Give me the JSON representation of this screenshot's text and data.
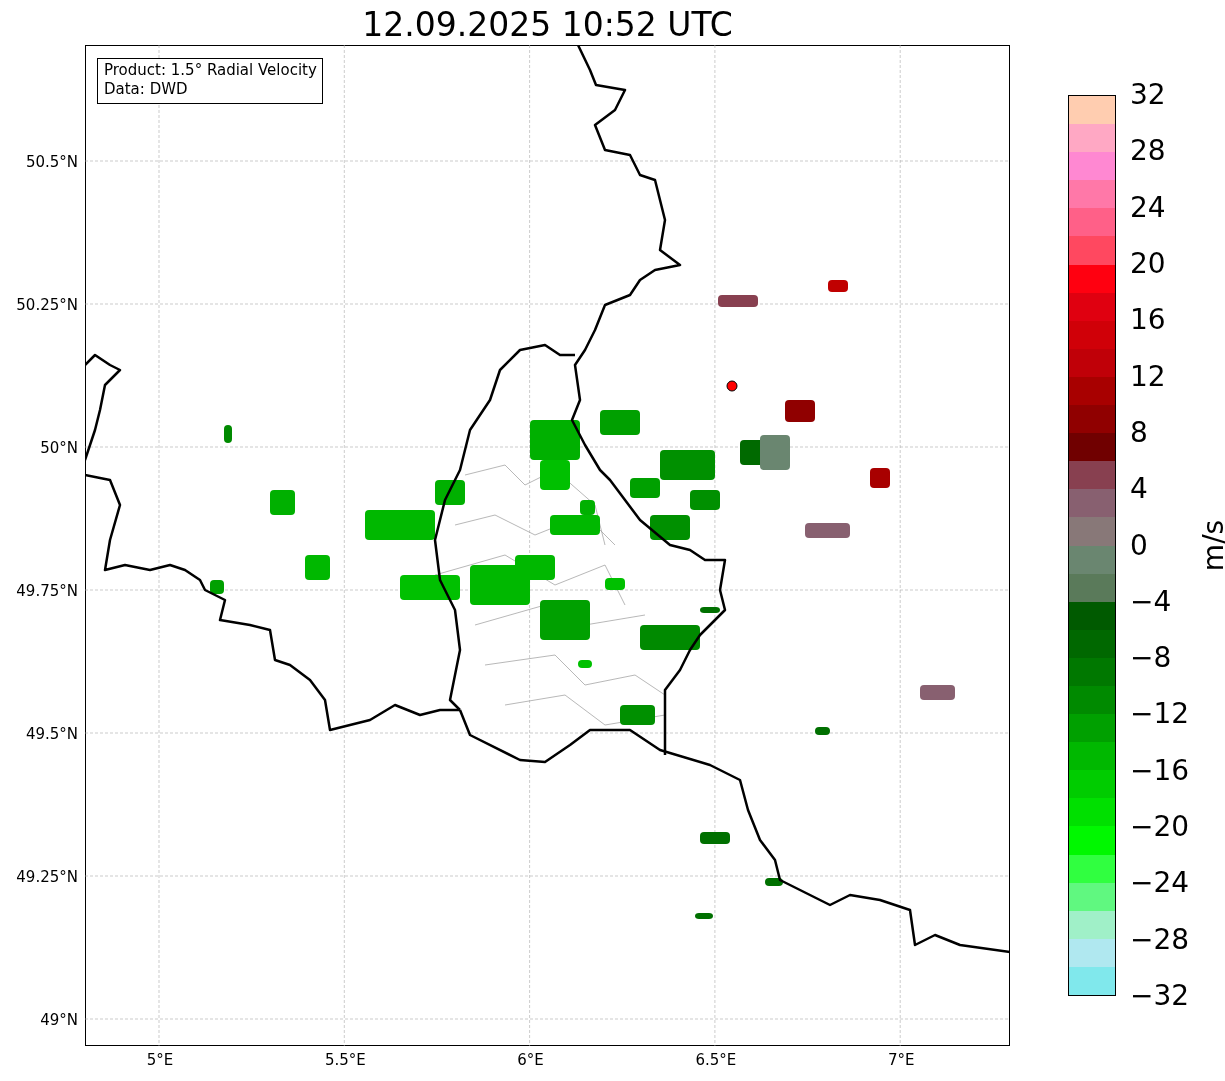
{
  "title": "12.09.2025 10:52 UTC",
  "info_box": {
    "lines": [
      "Product: 1.5° Radial Velocity",
      "Data: DWD"
    ]
  },
  "map": {
    "lat_labels": [
      "50.5°N",
      "50.25°N",
      "50°N",
      "49.75°N",
      "49.5°N",
      "49.25°N",
      "49°N"
    ],
    "lon_labels": [
      "5°E",
      "5.5°E",
      "6°E",
      "6.5°E",
      "7°E"
    ]
  },
  "colorbar": {
    "label": "m/s",
    "ticks": [
      "32",
      "28",
      "24",
      "20",
      "16",
      "12",
      "8",
      "4",
      "0",
      "−4",
      "−8",
      "−12",
      "−16",
      "−20",
      "−24",
      "−28",
      "−32"
    ],
    "bands": [
      {
        "color": "#ffcdb0"
      },
      {
        "color": "#ffa8c4"
      },
      {
        "color": "#ff88d2"
      },
      {
        "color": "#ff78a8"
      },
      {
        "color": "#ff6088"
      },
      {
        "color": "#ff4860"
      },
      {
        "color": "#ff0010"
      },
      {
        "color": "#e00010"
      },
      {
        "color": "#d00008"
      },
      {
        "color": "#c00008"
      },
      {
        "color": "#a80000"
      },
      {
        "color": "#900000"
      },
      {
        "color": "#700000"
      },
      {
        "color": "#884050"
      },
      {
        "color": "#886070"
      },
      {
        "color": "#887878"
      },
      {
        "color": "#6a8670"
      },
      {
        "color": "#5a7a5a"
      },
      {
        "color": "#005a00"
      },
      {
        "color": "#006800"
      },
      {
        "color": "#007800"
      },
      {
        "color": "#008a00"
      },
      {
        "color": "#00a000"
      },
      {
        "color": "#00b800"
      },
      {
        "color": "#00cc00"
      },
      {
        "color": "#00e000"
      },
      {
        "color": "#00f800"
      },
      {
        "color": "#30ff40"
      },
      {
        "color": "#60f880"
      },
      {
        "color": "#a0f0c8"
      },
      {
        "color": "#b0e8f0"
      },
      {
        "color": "#80e8ec"
      }
    ]
  }
}
